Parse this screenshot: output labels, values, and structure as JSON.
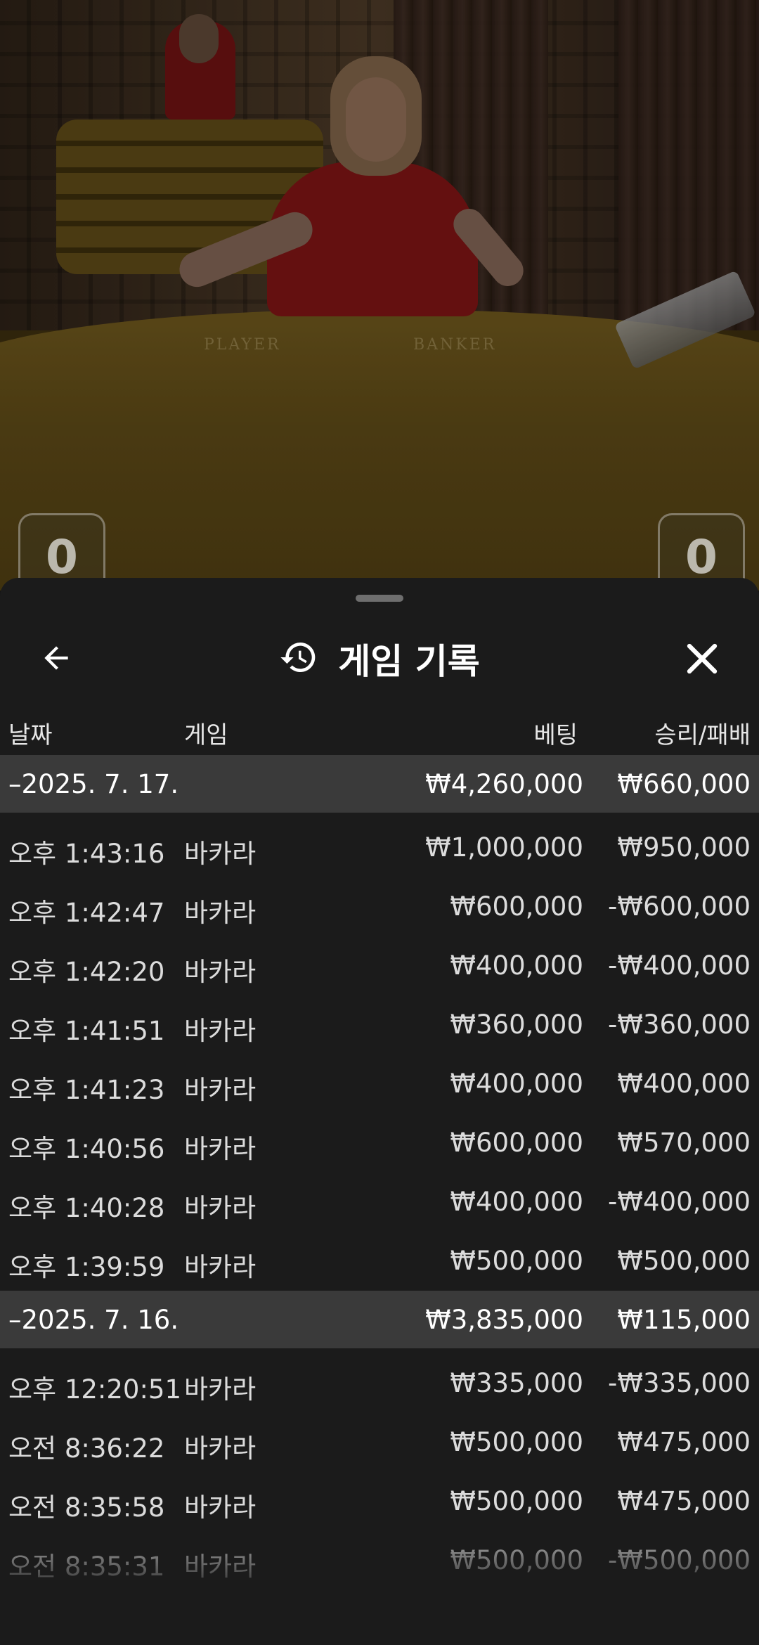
{
  "scores": {
    "player": "0",
    "banker": "0"
  },
  "table_labels": {
    "player": "PLAYER",
    "banker": "BANKER"
  },
  "sheet": {
    "title": "게임 기록",
    "icons": {
      "back": "arrow-left-icon",
      "history": "history-icon",
      "close": "close-icon"
    }
  },
  "columns": {
    "date": "날짜",
    "game": "게임",
    "bet": "베팅",
    "result": "승리/패배"
  },
  "groups": [
    {
      "date": "–2025. 7. 17.",
      "bet_total": "₩4,260,000",
      "result_total": "₩660,000",
      "rows": [
        {
          "time": "오후 1:43:16",
          "game": "바카라",
          "bet": "₩1,000,000",
          "result": "₩950,000"
        },
        {
          "time": "오후 1:42:47",
          "game": "바카라",
          "bet": "₩600,000",
          "result": "-₩600,000"
        },
        {
          "time": "오후 1:42:20",
          "game": "바카라",
          "bet": "₩400,000",
          "result": "-₩400,000"
        },
        {
          "time": "오후 1:41:51",
          "game": "바카라",
          "bet": "₩360,000",
          "result": "-₩360,000"
        },
        {
          "time": "오후 1:41:23",
          "game": "바카라",
          "bet": "₩400,000",
          "result": "₩400,000"
        },
        {
          "time": "오후 1:40:56",
          "game": "바카라",
          "bet": "₩600,000",
          "result": "₩570,000"
        },
        {
          "time": "오후 1:40:28",
          "game": "바카라",
          "bet": "₩400,000",
          "result": "-₩400,000"
        },
        {
          "time": "오후 1:39:59",
          "game": "바카라",
          "bet": "₩500,000",
          "result": "₩500,000"
        }
      ]
    },
    {
      "date": "–2025. 7. 16.",
      "bet_total": "₩3,835,000",
      "result_total": "₩115,000",
      "rows": [
        {
          "time": "오후 12:20:51",
          "game": "바카라",
          "bet": "₩335,000",
          "result": "-₩335,000"
        },
        {
          "time": "오전 8:36:22",
          "game": "바카라",
          "bet": "₩500,000",
          "result": "₩475,000"
        },
        {
          "time": "오전 8:35:58",
          "game": "바카라",
          "bet": "₩500,000",
          "result": "₩475,000"
        },
        {
          "time": "오전 8:35:31",
          "game": "바카라",
          "bet": "₩500,000",
          "result": "-₩500,000"
        }
      ]
    }
  ]
}
